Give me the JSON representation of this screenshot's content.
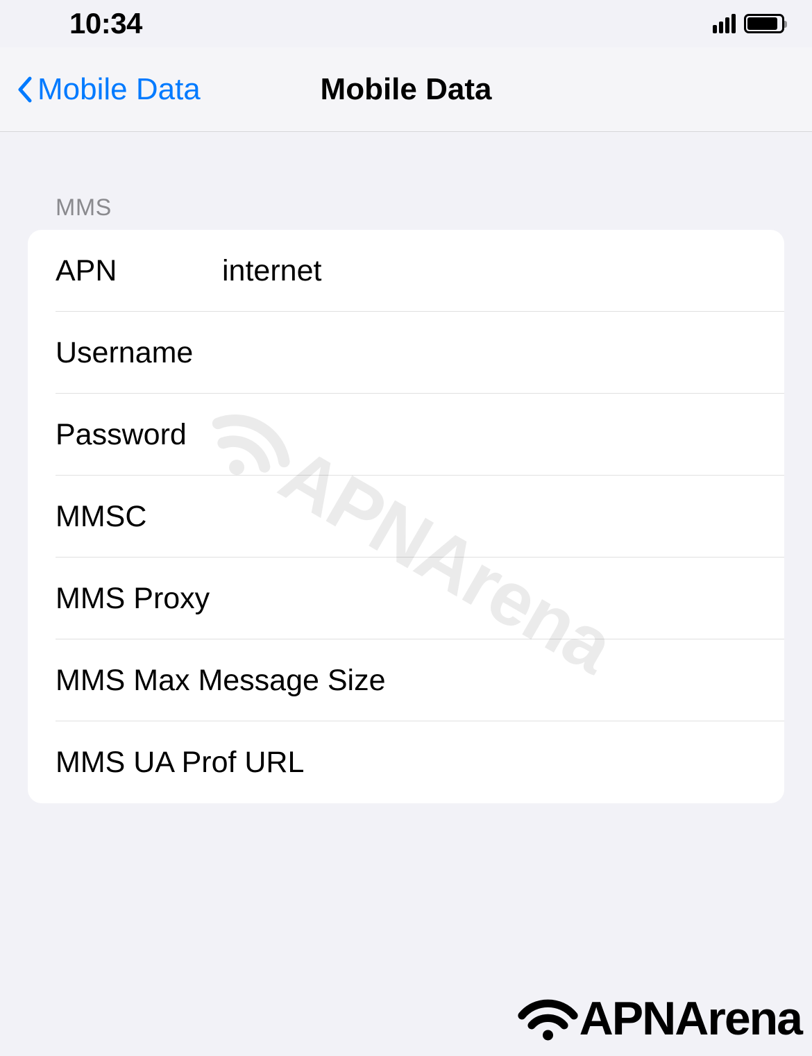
{
  "statusBar": {
    "time": "10:34"
  },
  "navBar": {
    "backLabel": "Mobile Data",
    "title": "Mobile Data"
  },
  "section": {
    "header": "MMS",
    "fields": {
      "apn": {
        "label": "APN",
        "value": "internet"
      },
      "username": {
        "label": "Username",
        "value": ""
      },
      "password": {
        "label": "Password",
        "value": ""
      },
      "mmsc": {
        "label": "MMSC",
        "value": ""
      },
      "mmsProxy": {
        "label": "MMS Proxy",
        "value": ""
      },
      "mmsMax": {
        "label": "MMS Max Message Size",
        "value": ""
      },
      "mmsUa": {
        "label": "MMS UA Prof URL",
        "value": ""
      }
    }
  },
  "watermark": "APNArena",
  "footerLogo": "APNArena"
}
